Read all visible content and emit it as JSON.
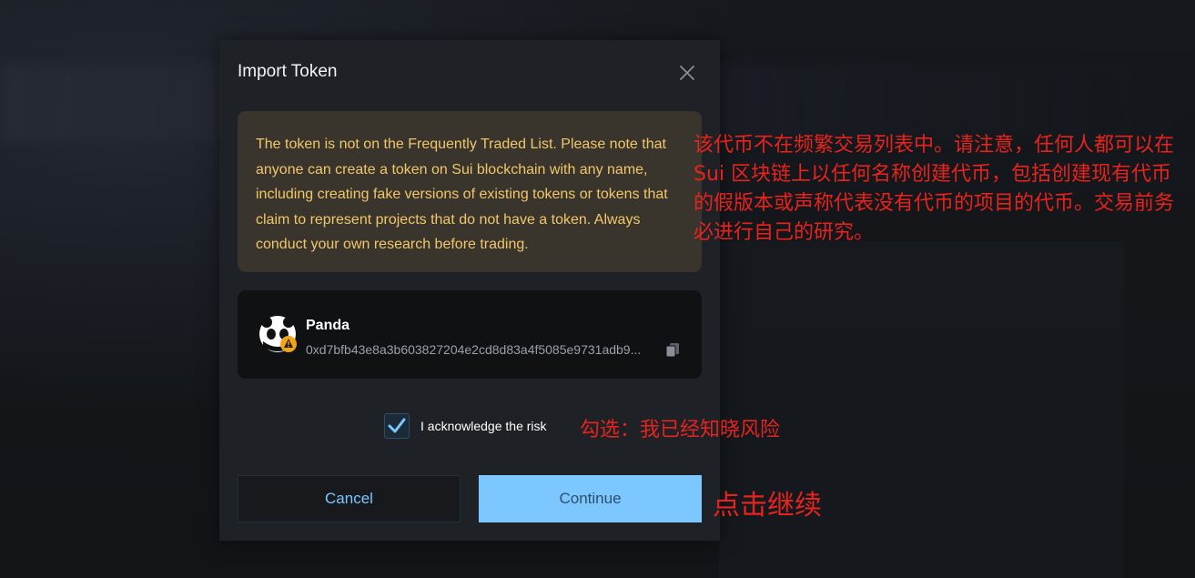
{
  "modal": {
    "title": "Import Token",
    "warning_text": "The token is not on the Frequently Traded List. Please note that anyone can create a token on Sui blockchain with any name, including creating fake versions of existing tokens or tokens that claim to represent projects that do not have a token. Always conduct your own research before trading.",
    "token": {
      "name": "Panda",
      "address": "0xd7bfb43e8a3b603827204e2cd8d83a4f5085e9731adb9..."
    },
    "acknowledge": {
      "label": "I acknowledge the risk",
      "checked": true
    },
    "buttons": {
      "cancel": "Cancel",
      "continue": "Continue"
    }
  },
  "annotations": {
    "warning_translation": "该代币不在频繁交易列表中。请注意，任何人都可以在 Sui 区块链上以任何名称创建代币，包括创建现有代币的假版本或声称代表没有代币的项目的代币。交易前务必进行自己的研究。",
    "checkbox_hint": "勾选：我已经知晓风险",
    "continue_hint": "点击继续"
  },
  "colors": {
    "accent": "#7cc7ff",
    "warning_text": "#f0c66b",
    "warning_bg": "#3a352c",
    "annotation": "#e8231d",
    "modal_bg": "#1e2226"
  },
  "icons": [
    "close-icon",
    "panda-avatar-icon",
    "warning-badge-icon",
    "copy-icon",
    "checkmark-icon"
  ]
}
